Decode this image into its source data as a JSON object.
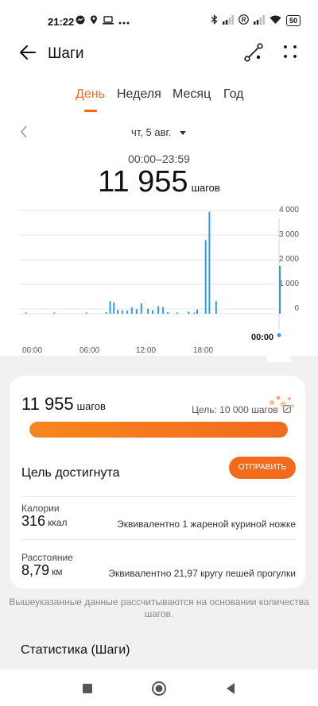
{
  "status_bar": {
    "time": "21:22",
    "left_icons": [
      "messenger-icon",
      "location-icon",
      "laptop-icon",
      "more-dots-icon"
    ],
    "battery": "50"
  },
  "header": {
    "title": "Шаги"
  },
  "tabs": [
    {
      "label": "День",
      "active": true
    },
    {
      "label": "Неделя",
      "active": false
    },
    {
      "label": "Месяц",
      "active": false
    },
    {
      "label": "Год",
      "active": false
    }
  ],
  "date": {
    "label": "чт, 5 авг."
  },
  "summary": {
    "range": "00:00–23:59",
    "steps": "11 955",
    "unit": "шагов"
  },
  "chart_data": {
    "type": "bar",
    "x_ticks": [
      "00:00",
      "06:00",
      "12:00",
      "18:00"
    ],
    "y_ticks": [
      "4 000",
      "3 000",
      "2 000",
      "1 000",
      "0"
    ],
    "current_label": "00:00",
    "ylim": [
      0,
      4000
    ],
    "bars": [
      {
        "t": 0.3,
        "v": 30
      },
      {
        "t": 3.3,
        "v": 30
      },
      {
        "t": 6.7,
        "v": 40
      },
      {
        "t": 8.8,
        "v": 60
      },
      {
        "t": 9.2,
        "v": 480
      },
      {
        "t": 9.6,
        "v": 440
      },
      {
        "t": 10.0,
        "v": 140
      },
      {
        "t": 10.5,
        "v": 130
      },
      {
        "t": 11.0,
        "v": 120
      },
      {
        "t": 11.5,
        "v": 240
      },
      {
        "t": 12.0,
        "v": 180
      },
      {
        "t": 12.5,
        "v": 400
      },
      {
        "t": 13.2,
        "v": 190
      },
      {
        "t": 13.7,
        "v": 130
      },
      {
        "t": 14.3,
        "v": 290
      },
      {
        "t": 14.8,
        "v": 260
      },
      {
        "t": 15.3,
        "v": 60
      },
      {
        "t": 16.3,
        "v": 40
      },
      {
        "t": 17.5,
        "v": 80
      },
      {
        "t": 18.1,
        "v": 40
      },
      {
        "t": 18.4,
        "v": 160
      },
      {
        "t": 19.3,
        "v": 2850
      },
      {
        "t": 19.7,
        "v": 3950
      },
      {
        "t": 20.4,
        "v": 490
      }
    ]
  },
  "card": {
    "steps": "11 955",
    "unit": "шагов",
    "goal": "Цель: 10 000 шагов",
    "progress": 1.0,
    "goal_reached": "Цель достигнута",
    "send_label": "ОТПРАВИТЬ",
    "calories": {
      "label": "Калории",
      "value": "316",
      "unit": "ккал",
      "equivalent": "Эквивалентно 1 жареной куриной ножке"
    },
    "distance": {
      "label": "Расстояние",
      "value": "8,79",
      "unit": "км",
      "equivalent": "Эквивалентно 21,97 кругу пешей прогулки"
    }
  },
  "note": "Вышеуказанные данные рассчитываются на основании количества шагов.",
  "stats_title": "Статистика (Шаги)",
  "colors": {
    "accent": "#f26b1d",
    "bar": "#2d9be8"
  }
}
